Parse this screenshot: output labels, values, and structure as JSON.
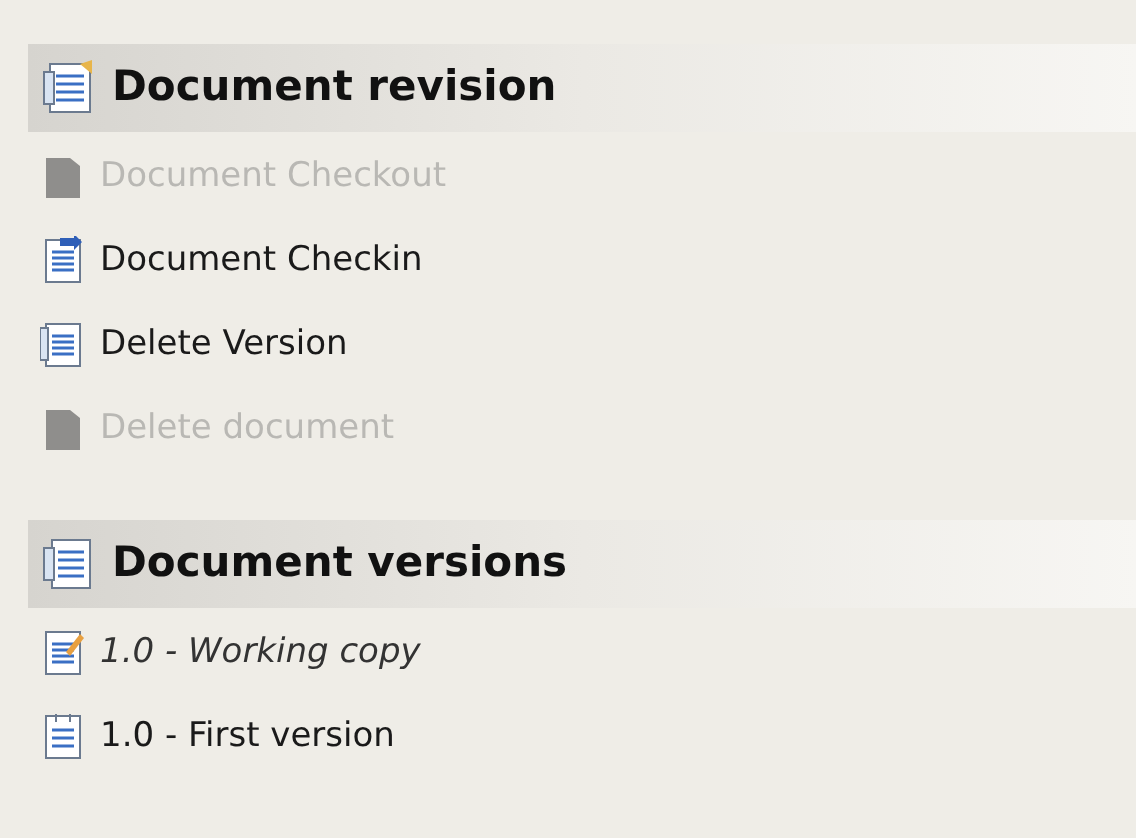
{
  "sections": [
    {
      "title": "Document revision",
      "kind": "revision",
      "items": [
        {
          "label": "Document Checkout",
          "disabled": true
        },
        {
          "label": "Document Checkin",
          "kind": "checkin",
          "disabled": false
        },
        {
          "label": "Delete Version",
          "kind": "list",
          "disabled": false
        },
        {
          "label": "Delete document",
          "disabled": true
        }
      ]
    },
    {
      "title": "Document versions",
      "kind": "versions",
      "items": [
        {
          "label": "1.0 - Working copy",
          "kind": "working",
          "current": true
        },
        {
          "label": "1.0 - First version",
          "kind": "version",
          "current": false
        }
      ]
    }
  ]
}
